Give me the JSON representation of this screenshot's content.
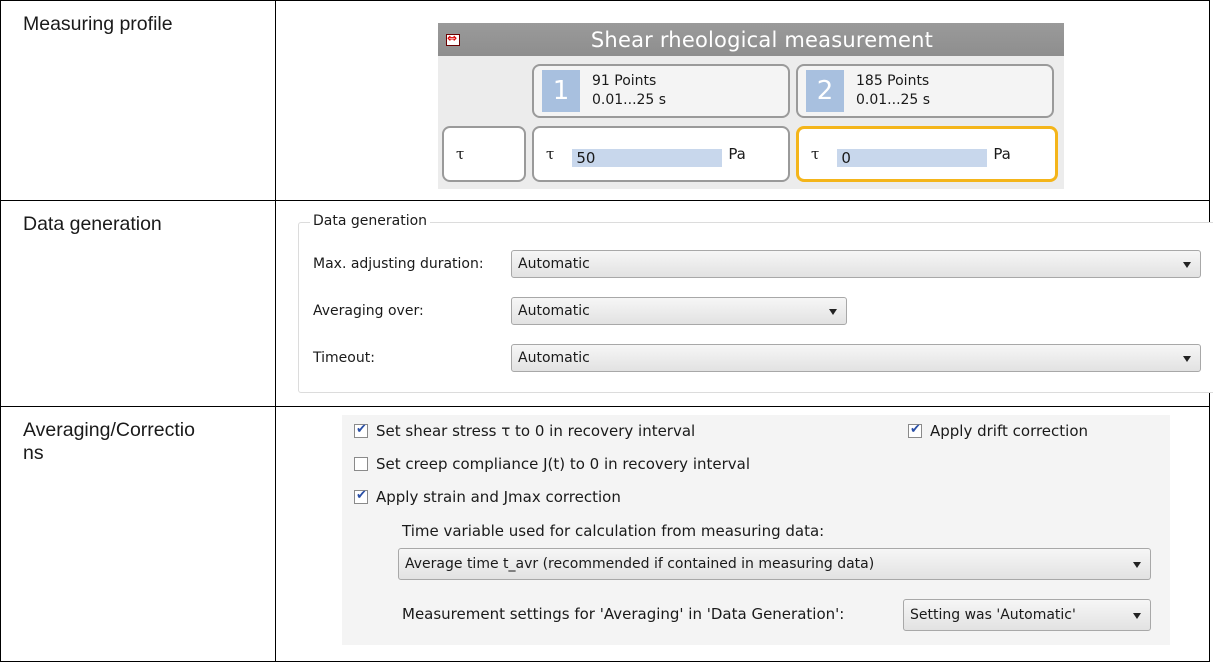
{
  "rows": {
    "profile_label": "Measuring profile",
    "datagen_label": "Data generation",
    "averaging_label": "Averaging/Correctio ns"
  },
  "profile": {
    "title": "Shear rheological measurement",
    "intervals": [
      {
        "number": "1",
        "points": "91 Points",
        "range": "0.01...25 s"
      },
      {
        "number": "2",
        "points": "185 Points",
        "range": "0.01...25 s"
      }
    ],
    "row_symbol": "τ",
    "cells": [
      {
        "symbol": "τ",
        "value": "50",
        "unit": "Pa"
      },
      {
        "symbol": "τ",
        "value": "0",
        "unit": "Pa"
      }
    ]
  },
  "datagen": {
    "legend": "Data generation",
    "fields": [
      {
        "label": "Max. adjusting duration:",
        "value": "Automatic"
      },
      {
        "label": "Averaging over:",
        "value": "Automatic"
      },
      {
        "label": "Timeout:",
        "value": "Automatic"
      }
    ]
  },
  "averaging": {
    "set_shear_stress": {
      "label": "Set shear stress τ to 0 in recovery interval",
      "checked": true
    },
    "apply_drift": {
      "label": "Apply drift correction",
      "checked": true
    },
    "set_creep": {
      "label": "Set creep compliance J(t) to 0 in recovery interval",
      "checked": false
    },
    "apply_strain": {
      "label": "Apply strain and Jmax correction",
      "checked": true
    },
    "time_variable_label": "Time variable used for calculation from measuring data:",
    "time_variable_value": "Average time t_avr (recommended if contained in measuring data)",
    "meas_settings_label": "Measurement settings for 'Averaging' in 'Data Generation':",
    "meas_settings_value": "Setting was 'Automatic'"
  }
}
